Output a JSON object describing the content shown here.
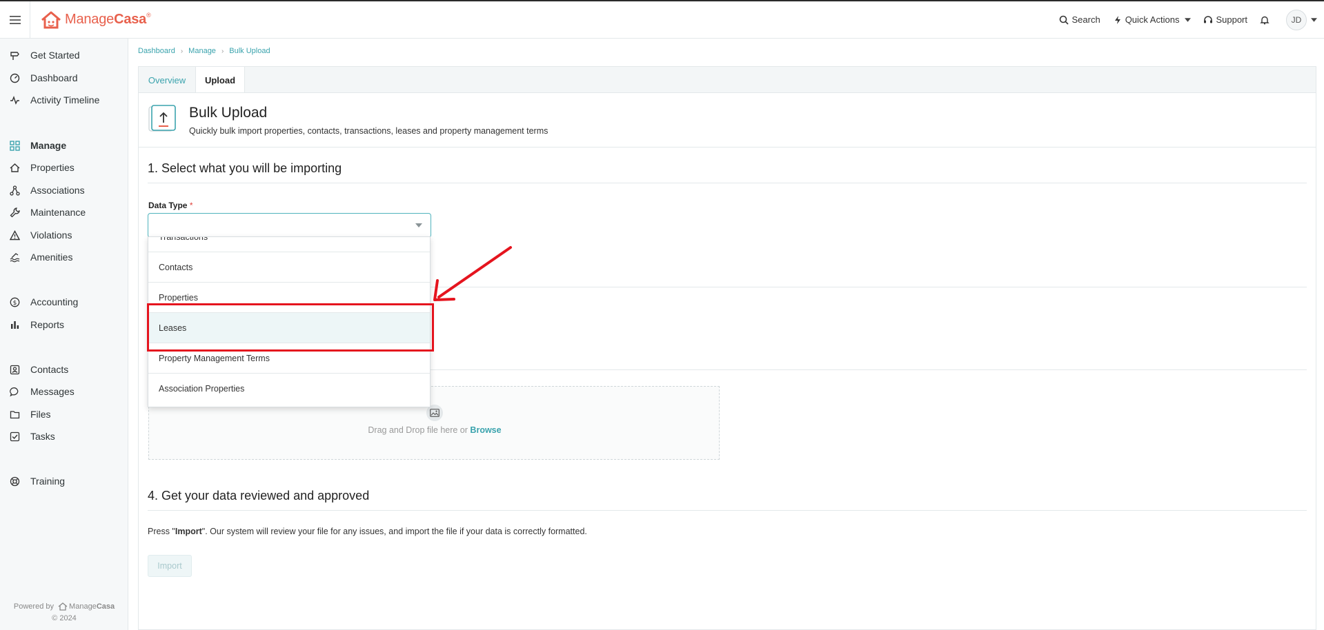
{
  "app": {
    "brand_prefix": "Manage",
    "brand_suffix": "Casa",
    "brand_mark": "®",
    "accent_color": "#3aa3ad",
    "brand_color": "#e8604c"
  },
  "topbar": {
    "search_label": "Search",
    "quick_actions_label": "Quick Actions",
    "support_label": "Support",
    "avatar_initials": "JD"
  },
  "sidebar": {
    "items": [
      {
        "label": "Get Started",
        "icon": "signpost-icon"
      },
      {
        "label": "Dashboard",
        "icon": "gauge-icon"
      },
      {
        "label": "Activity Timeline",
        "icon": "pulse-icon"
      },
      {
        "label": "Manage",
        "icon": "grid-icon"
      },
      {
        "label": "Properties",
        "icon": "house-icon"
      },
      {
        "label": "Associations",
        "icon": "network-icon"
      },
      {
        "label": "Maintenance",
        "icon": "wrench-icon"
      },
      {
        "label": "Violations",
        "icon": "warning-icon"
      },
      {
        "label": "Amenities",
        "icon": "pool-icon"
      },
      {
        "label": "Accounting",
        "icon": "dollar-icon"
      },
      {
        "label": "Reports",
        "icon": "bar-chart-icon"
      },
      {
        "label": "Contacts",
        "icon": "contact-card-icon"
      },
      {
        "label": "Messages",
        "icon": "chat-icon"
      },
      {
        "label": "Files",
        "icon": "folder-icon"
      },
      {
        "label": "Tasks",
        "icon": "checkbox-icon"
      },
      {
        "label": "Training",
        "icon": "lifebuoy-icon"
      }
    ],
    "powered_by": "Powered by",
    "powered_brand_prefix": "Manage",
    "powered_brand_suffix": "Casa",
    "copyright": "© 2024"
  },
  "breadcrumb": {
    "items": [
      "Dashboard",
      "Manage",
      "Bulk Upload"
    ]
  },
  "tabs": {
    "overview": "Overview",
    "upload": "Upload"
  },
  "header": {
    "title": "Bulk Upload",
    "subtitle": "Quickly bulk import properties, contacts, transactions, leases and property management terms"
  },
  "step1": {
    "title": "1. Select what you will be importing",
    "field_label": "Data Type",
    "required_mark": "*",
    "value": ""
  },
  "dropdown": {
    "options": [
      "Transactions",
      "Contacts",
      "Properties",
      "Leases",
      "Property Management Terms",
      "Association Properties"
    ],
    "highlighted": "Leases"
  },
  "upload": {
    "drop_text": "Drag and Drop file here or",
    "browse_label": "Browse"
  },
  "step4": {
    "title": "4. Get your data reviewed and approved",
    "note_before": "Press \"",
    "note_bold": "Import",
    "note_after": "\". Our system will review your file for any issues, and import the file if your data is correctly formatted.",
    "import_button": "Import"
  }
}
